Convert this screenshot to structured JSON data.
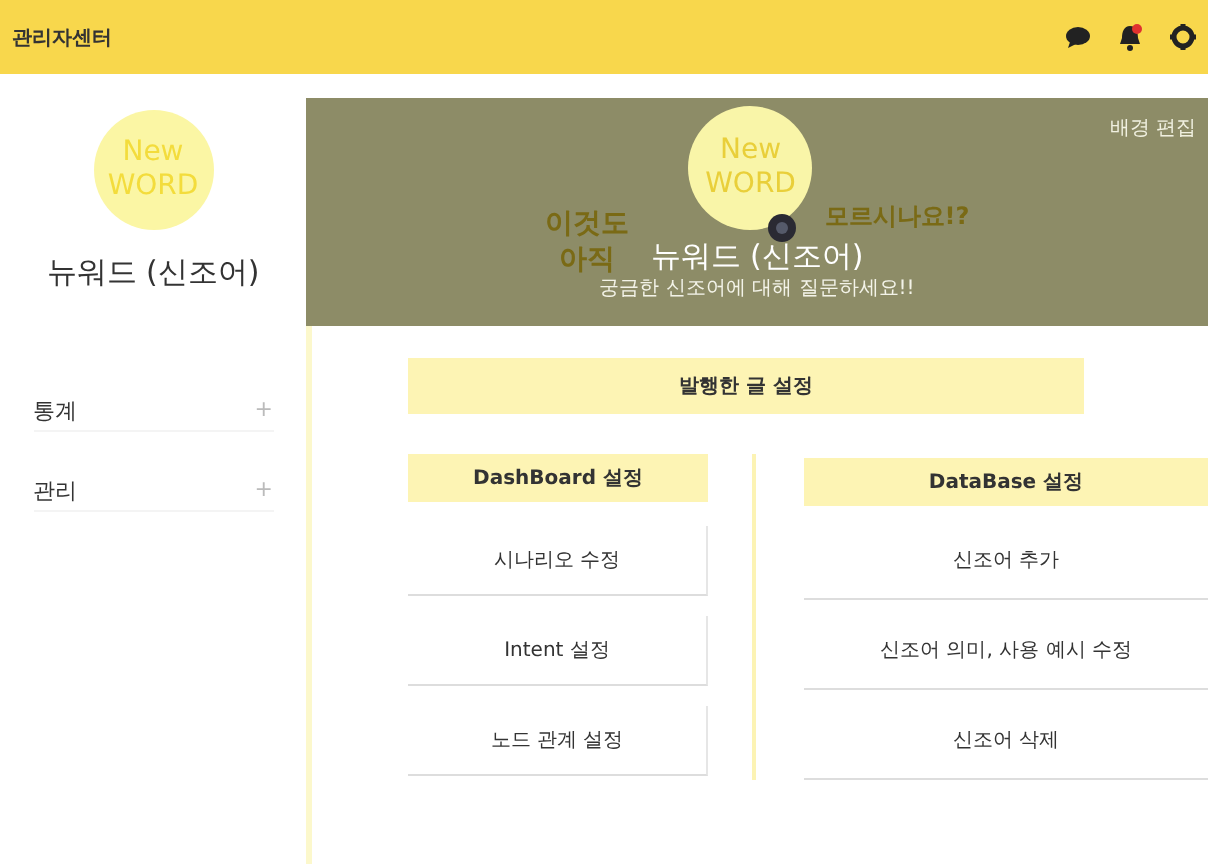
{
  "header": {
    "title": "관리자센터"
  },
  "sidebar": {
    "logo": [
      "New",
      "WORD"
    ],
    "name": "뉴워드 (신조어)",
    "items": [
      {
        "label": "통계",
        "expander": "+"
      },
      {
        "label": "관리",
        "expander": "+"
      }
    ]
  },
  "banner": {
    "edit_link": "배경 편집",
    "logo": [
      "New",
      "WORD"
    ],
    "left_text": [
      "이것도",
      "아직"
    ],
    "right_text": "모르시나요!?",
    "title": "뉴워드 (신조어)",
    "subtitle": "궁금한 신조어에 대해 질문하세요!!"
  },
  "section_title": "발행한 글 설정",
  "columns": [
    {
      "heading": "DashBoard 설정",
      "buttons": [
        "시나리오 수정",
        "Intent 설정",
        "노드 관계 설정"
      ]
    },
    {
      "heading": "DataBase 설정",
      "buttons": [
        "신조어 추가",
        "신조어 의미, 사용 예시 수정",
        "신조어 삭제"
      ]
    }
  ]
}
